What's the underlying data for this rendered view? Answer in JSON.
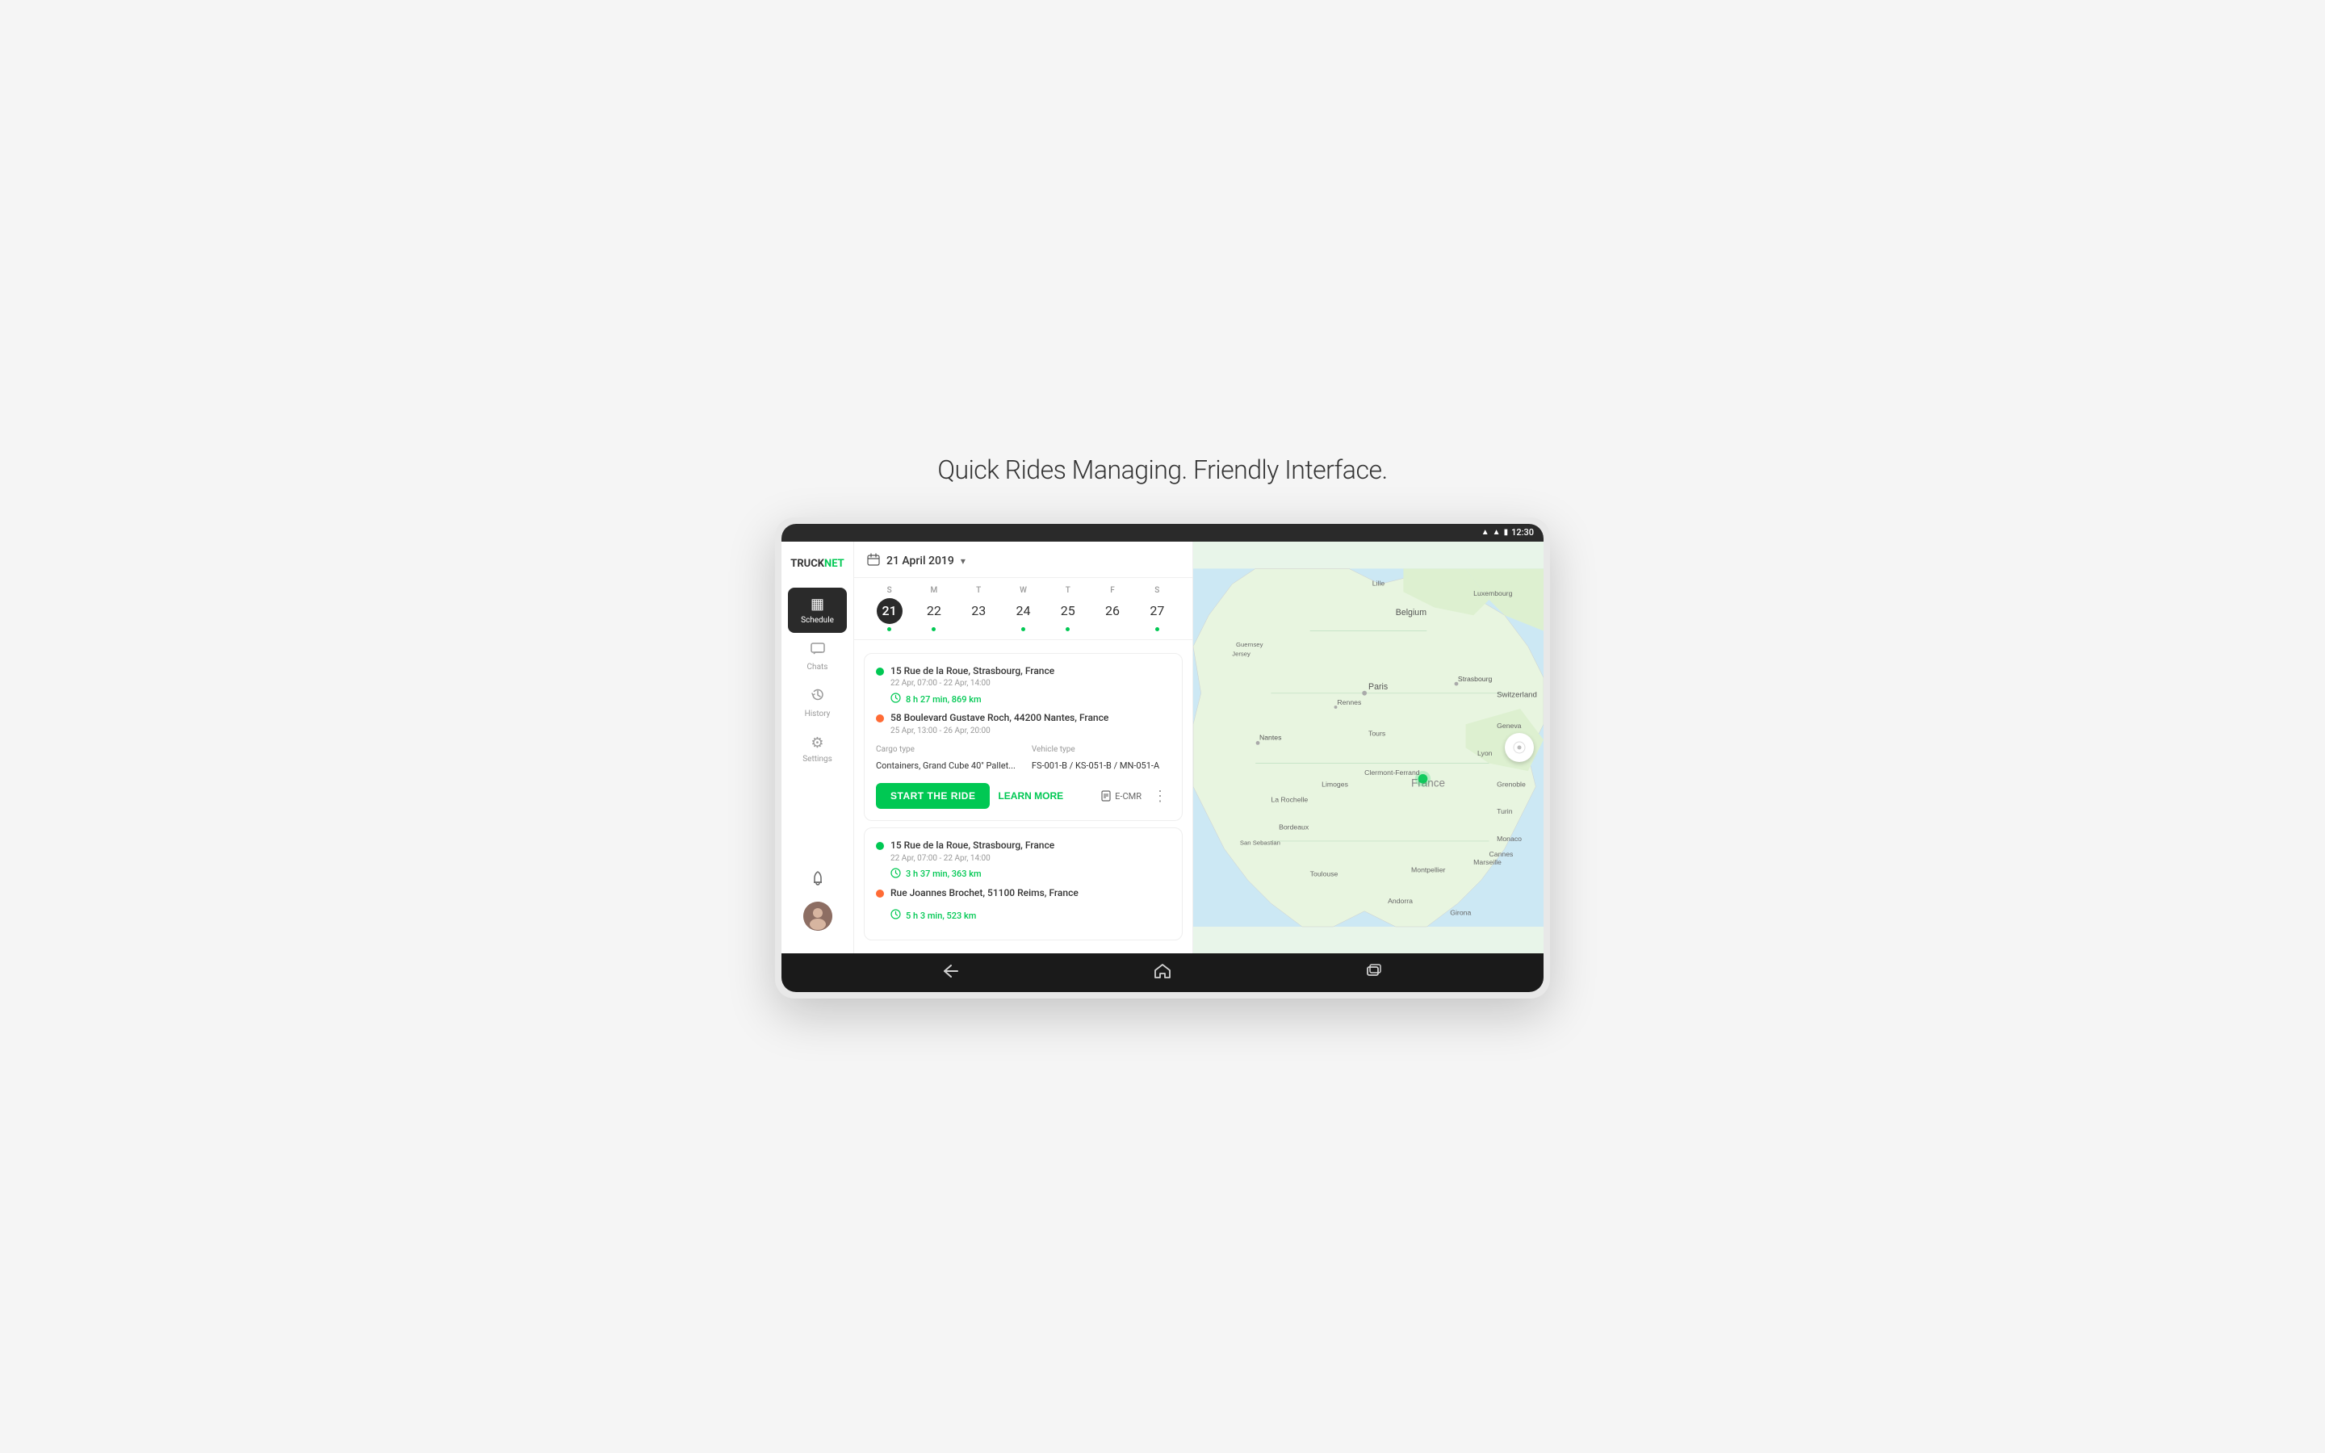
{
  "page": {
    "title": "Quick Rides Managing. Friendly Interface."
  },
  "status_bar": {
    "time": "12:30",
    "wifi": "▲",
    "signal": "▲",
    "battery": "▮"
  },
  "sidebar": {
    "logo": "TRUCK",
    "logo_accent": "NET",
    "nav_items": [
      {
        "id": "schedule",
        "label": "Schedule",
        "icon": "▦",
        "active": true
      },
      {
        "id": "chats",
        "label": "Chats",
        "icon": "💬",
        "active": false
      },
      {
        "id": "history",
        "label": "History",
        "icon": "↺",
        "active": false
      },
      {
        "id": "settings",
        "label": "Settings",
        "icon": "⚙",
        "active": false
      }
    ]
  },
  "date_header": {
    "label": "21 April 2019",
    "icon": "📅"
  },
  "week": {
    "days": [
      {
        "letter": "S",
        "number": "21",
        "today": true,
        "has_dot": true
      },
      {
        "letter": "M",
        "number": "22",
        "today": false,
        "has_dot": true
      },
      {
        "letter": "T",
        "number": "23",
        "today": false,
        "has_dot": false
      },
      {
        "letter": "W",
        "number": "24",
        "today": false,
        "has_dot": true
      },
      {
        "letter": "T",
        "number": "25",
        "today": false,
        "has_dot": true
      },
      {
        "letter": "F",
        "number": "26",
        "today": false,
        "has_dot": false
      },
      {
        "letter": "S",
        "number": "27",
        "today": false,
        "has_dot": true
      }
    ]
  },
  "rides": [
    {
      "id": "ride1",
      "origin": "15 Rue de la Roue, Strasbourg, France",
      "origin_time": "22 Apr, 07:00 - 22 Apr, 14:00",
      "duration": "8 h 27 min, 869 km",
      "destination": "58 Boulevard Gustave Roch, 44200 Nantes, France",
      "dest_time": "25 Apr, 13:00 - 26 Apr, 20:00",
      "cargo_type_label": "Cargo type",
      "cargo_type_value": "Containers, Grand Cube 40\" Pallet...",
      "vehicle_type_label": "Vehicle type",
      "vehicle_type_value": "FS-001-B / KS-051-B / MN-051-A",
      "actions": {
        "start": "START THE RIDE",
        "learn": "LEARN MORE",
        "ecmr": "E-CMR"
      }
    },
    {
      "id": "ride2",
      "origin": "15 Rue de la Roue, Strasbourg, France",
      "origin_time": "22 Apr, 07:00 - 22 Apr, 14:00",
      "duration": "3 h 37 min, 363 km",
      "destination": "Rue Joannes Brochet, 51100 Reims, France",
      "dest_time": "",
      "second_duration": "5 h 3 min, 523 km"
    }
  ],
  "nav_bar": {
    "back": "←",
    "home": "⌂",
    "recents": "▣"
  }
}
